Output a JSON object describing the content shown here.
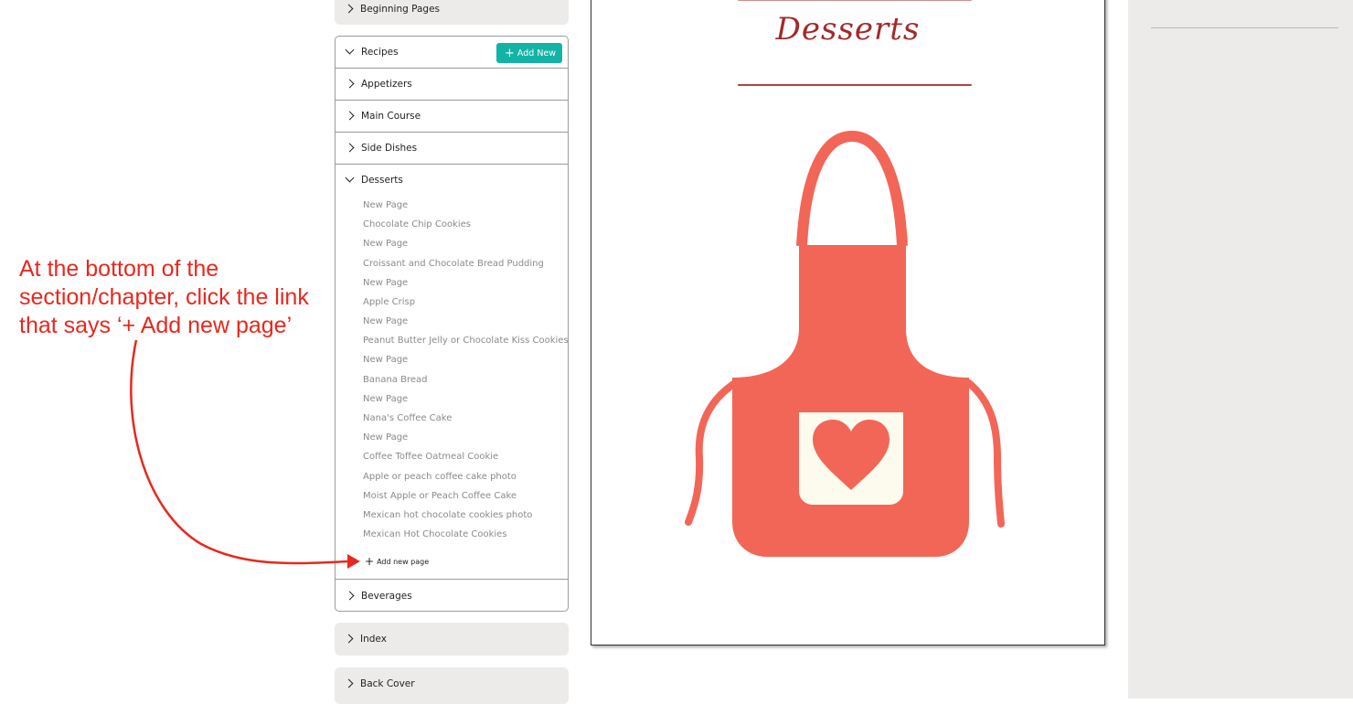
{
  "annotation": {
    "lines": [
      "At the bottom of the",
      "section/chapter, click the link",
      "that says ‘+ Add new page’"
    ],
    "color": "#e8281e"
  },
  "sidebar": {
    "beginning_pages": "Beginning Pages",
    "recipes": {
      "label": "Recipes",
      "add_new": "Add New",
      "categories": [
        "Appetizers",
        "Main Course",
        "Side Dishes"
      ],
      "desserts": {
        "label": "Desserts",
        "pages": [
          "New Page",
          "Chocolate Chip Cookies",
          "New Page",
          "Croissant and Chocolate Bread Pudding",
          "New Page",
          "Apple Crisp",
          "New Page",
          "Peanut Butter Jelly or Chocolate Kiss Cookies",
          "New Page",
          "Banana Bread",
          "New Page",
          "Nana's Coffee Cake",
          "New Page",
          "Coffee Toffee Oatmeal Cookie",
          "Apple or peach coffee cake photo",
          "Moist Apple or Peach Coffee Cake",
          "Mexican hot chocolate cookies photo",
          "Mexican Hot Chocolate Cookies"
        ],
        "add_page": "Add new page"
      },
      "beverages": "Beverages"
    },
    "index": "Index",
    "back_cover": "Back Cover"
  },
  "document": {
    "title": "Desserts",
    "apron_color": "#f26657",
    "pocket_color": "#fdfbee"
  },
  "colors": {
    "accent": "#13b3a6",
    "panel": "#ecebea",
    "title": "#a3292a"
  }
}
